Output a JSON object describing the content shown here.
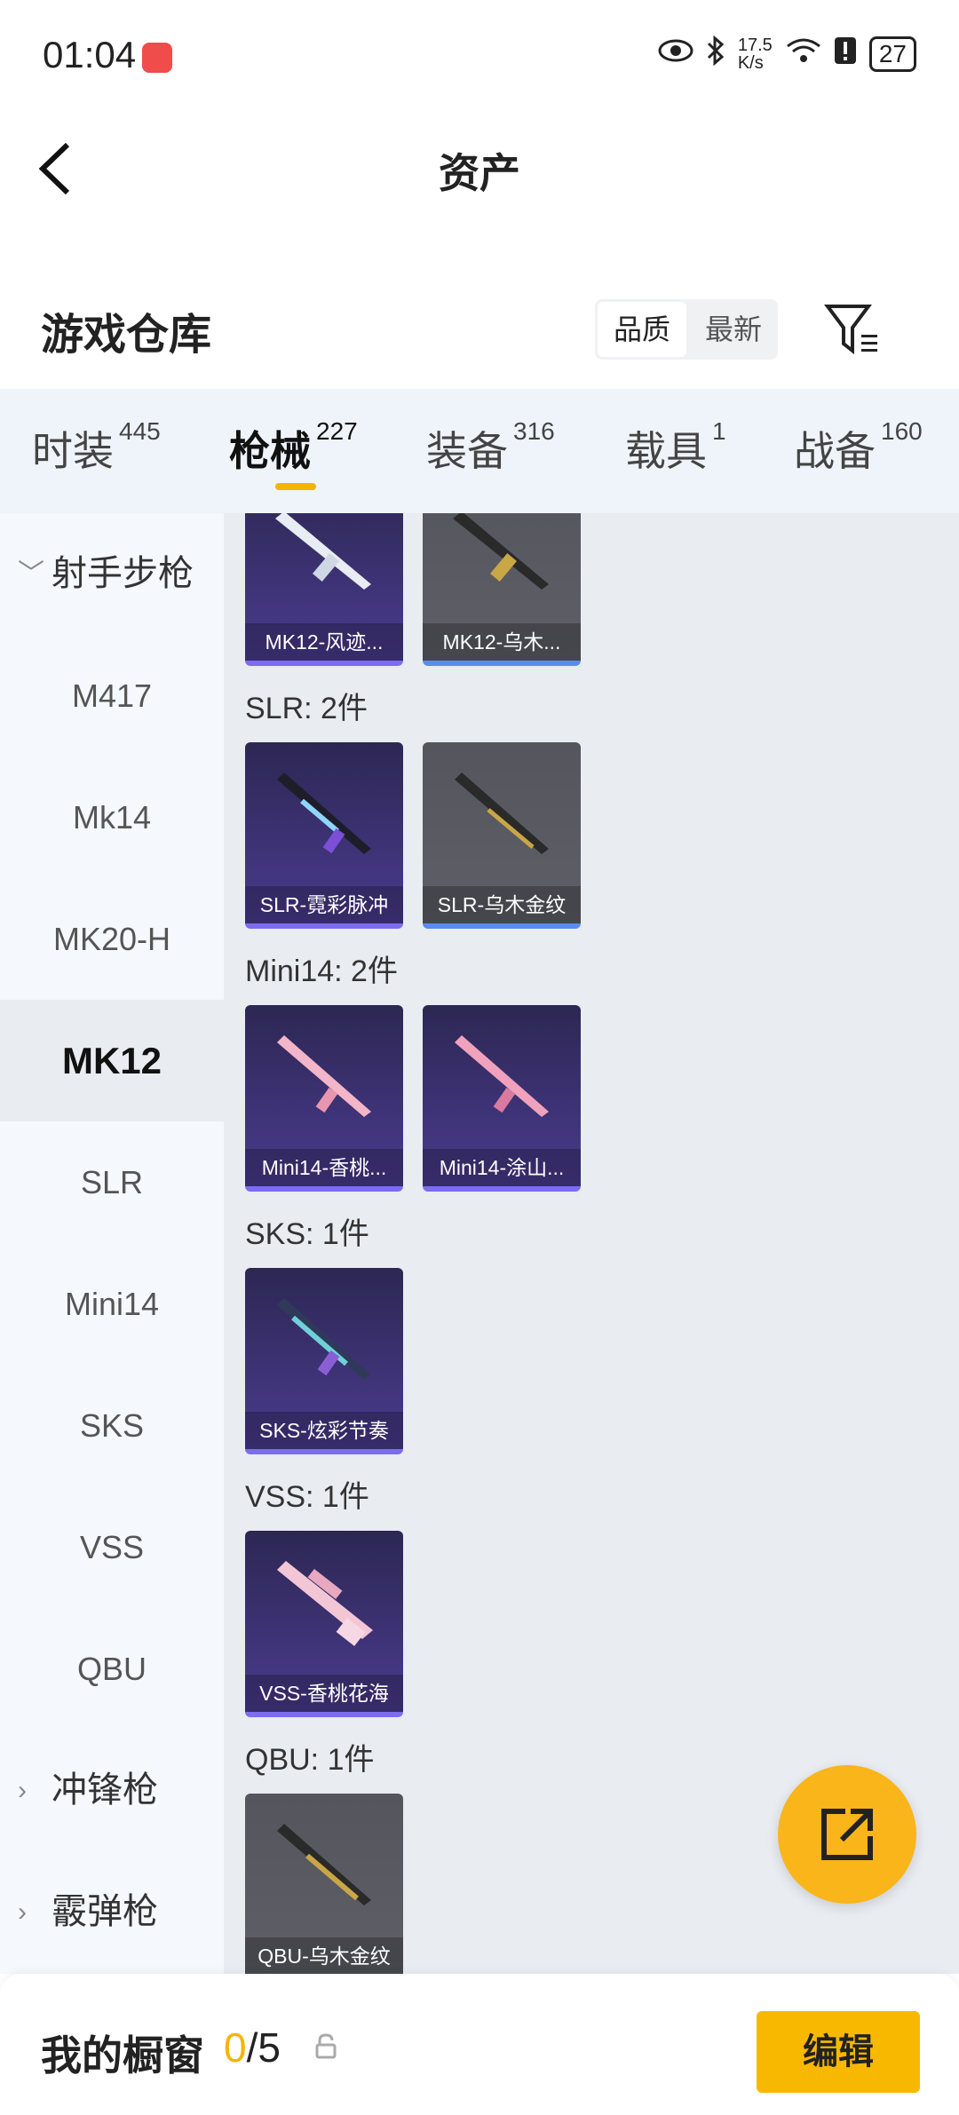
{
  "status": {
    "time": "01:04",
    "speed": "17.5 K/s",
    "battery": "27"
  },
  "header": {
    "title": "资产"
  },
  "section": {
    "title": "游戏仓库",
    "sort_options": [
      "品质",
      "最新"
    ]
  },
  "tabs": [
    {
      "label": "时装",
      "count": "445"
    },
    {
      "label": "枪械",
      "count": "227"
    },
    {
      "label": "装备",
      "count": "316"
    },
    {
      "label": "载具",
      "count": "1"
    },
    {
      "label": "战备",
      "count": "160"
    }
  ],
  "sidebar": {
    "items": [
      "射手步枪",
      "M417",
      "Mk14",
      "MK20-H",
      "MK12",
      "SLR",
      "Mini14",
      "SKS",
      "VSS",
      "QBU",
      "冲锋枪",
      "霰弹枪"
    ]
  },
  "content": {
    "groups": [
      {
        "label": "",
        "items": [
          "MK12-风迹...",
          "MK12-乌木..."
        ]
      },
      {
        "label": "SLR: 2件",
        "items": [
          "SLR-霓彩脉冲",
          "SLR-乌木金纹"
        ]
      },
      {
        "label": "Mini14: 2件",
        "items": [
          "Mini14-香桃...",
          "Mini14-涂山..."
        ]
      },
      {
        "label": "SKS: 1件",
        "items": [
          "SKS-炫彩节奏"
        ]
      },
      {
        "label": "VSS: 1件",
        "items": [
          "VSS-香桃花海"
        ]
      },
      {
        "label": "QBU: 1件",
        "items": [
          "QBU-乌木金纹"
        ]
      }
    ]
  },
  "bottom": {
    "title": "我的橱窗",
    "count_current": "0",
    "count_total": "/5",
    "edit_label": "编辑"
  },
  "colors": {
    "accent": "#f5b400",
    "purple_card": "#3b3170",
    "grey_card": "#5a5b63"
  }
}
